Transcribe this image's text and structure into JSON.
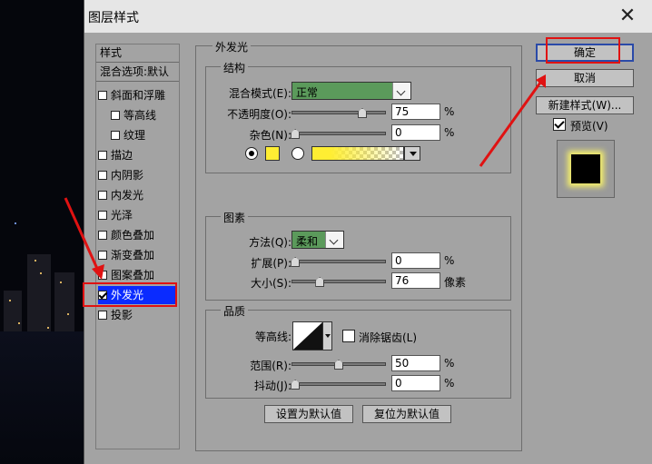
{
  "dialog": {
    "title": "图层样式"
  },
  "style_list": {
    "header": "样式",
    "blend_options": "混合选项:默认",
    "items": [
      {
        "label": "斜面和浮雕",
        "checked": false,
        "indent": false
      },
      {
        "label": "等高线",
        "checked": false,
        "indent": true
      },
      {
        "label": "纹理",
        "checked": false,
        "indent": true
      },
      {
        "label": "描边",
        "checked": false,
        "indent": false
      },
      {
        "label": "内阴影",
        "checked": false,
        "indent": false
      },
      {
        "label": "内发光",
        "checked": false,
        "indent": false
      },
      {
        "label": "光泽",
        "checked": false,
        "indent": false
      },
      {
        "label": "颜色叠加",
        "checked": false,
        "indent": false
      },
      {
        "label": "渐变叠加",
        "checked": false,
        "indent": false
      },
      {
        "label": "图案叠加",
        "checked": false,
        "indent": false
      },
      {
        "label": "外发光",
        "checked": true,
        "indent": false
      },
      {
        "label": "投影",
        "checked": false,
        "indent": false
      }
    ]
  },
  "outer_glow": {
    "title": "外发光",
    "structure": {
      "title": "结构",
      "blend_mode_label": "混合模式(E):",
      "blend_mode_value": "正常",
      "opacity_label": "不透明度(O):",
      "opacity_value": "75",
      "noise_label": "杂色(N):",
      "noise_value": "0",
      "unit": "%",
      "glow_color": "#ffee33"
    },
    "elements": {
      "title": "图素",
      "technique_label": "方法(Q):",
      "technique_value": "柔和",
      "spread_label": "扩展(P):",
      "spread_value": "0",
      "size_label": "大小(S):",
      "size_value": "76",
      "size_unit": "像素",
      "unit": "%"
    },
    "quality": {
      "title": "品质",
      "contour_label": "等高线:",
      "antialias_label": "消除锯齿(L)",
      "range_label": "范围(R):",
      "range_value": "50",
      "jitter_label": "抖动(J):",
      "jitter_value": "0",
      "unit": "%"
    },
    "set_default": "设置为默认值",
    "reset_default": "复位为默认值"
  },
  "buttons": {
    "ok": "确定",
    "cancel": "取消",
    "new_style": "新建样式(W)...",
    "preview": "预览(V)"
  },
  "colors": {
    "selection": "#0a2bff",
    "annotation": "#e01212",
    "combo_green": "#5b9a5b"
  }
}
